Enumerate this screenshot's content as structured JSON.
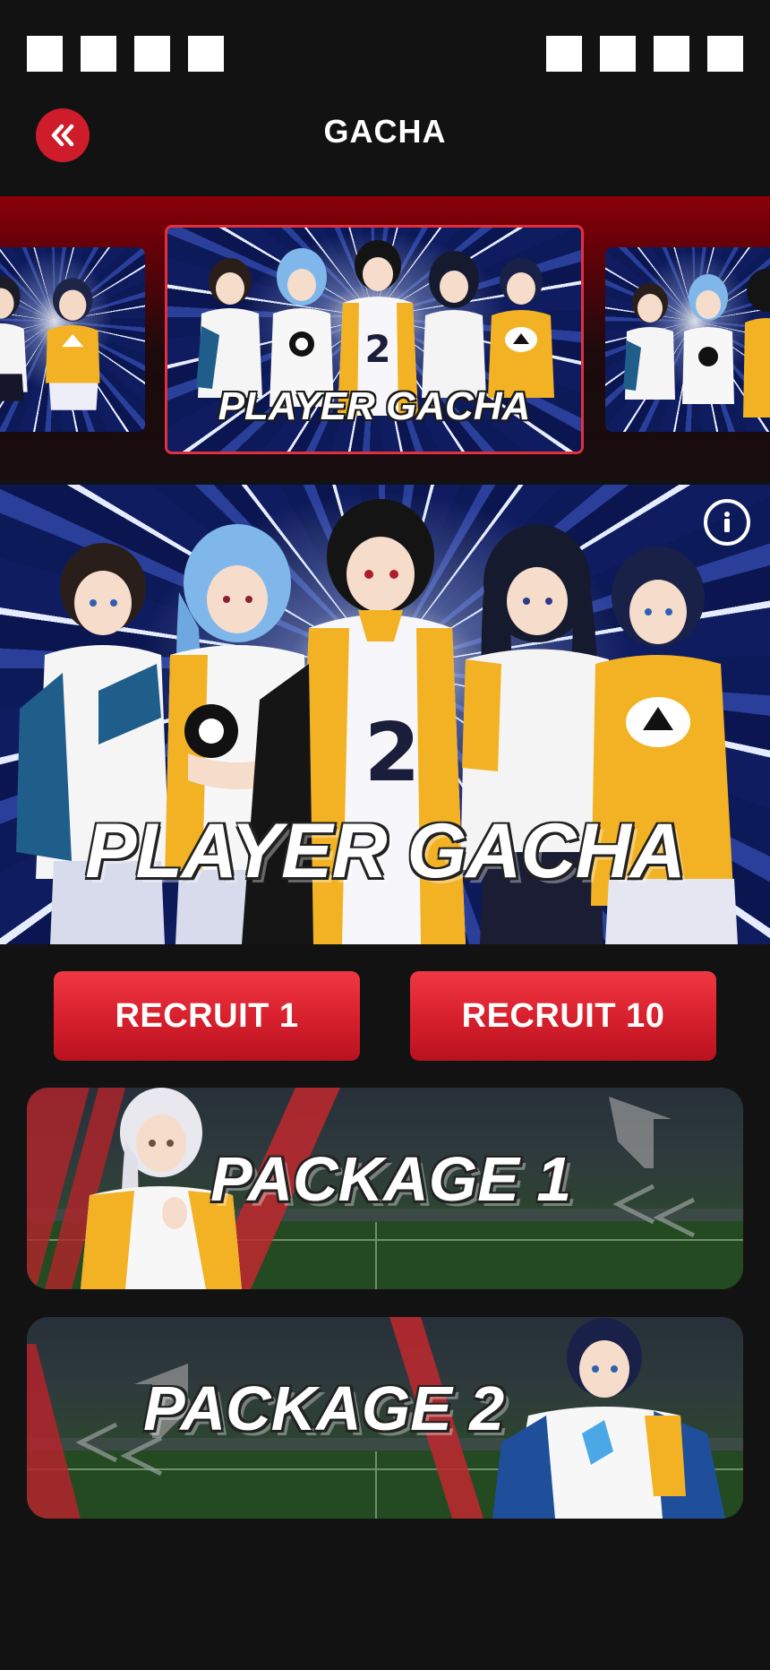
{
  "header": {
    "title": "GACHA",
    "back_icon": "double-chevron-left-icon"
  },
  "colors": {
    "accent": "#cf1c2a",
    "background": "#121212",
    "highlight_border": "#e2303c"
  },
  "carousel": {
    "slides": [
      {
        "label": ""
      },
      {
        "label": "PLAYER GACHA"
      },
      {
        "label": ""
      }
    ]
  },
  "hero": {
    "title": "PLAYER GACHA",
    "info_icon": "info-icon"
  },
  "recruit": {
    "single_label": "RECRUIT 1",
    "multi_label": "RECRUIT 10"
  },
  "packages": [
    {
      "title": "PACKAGE 1"
    },
    {
      "title": "PACKAGE 2"
    }
  ]
}
